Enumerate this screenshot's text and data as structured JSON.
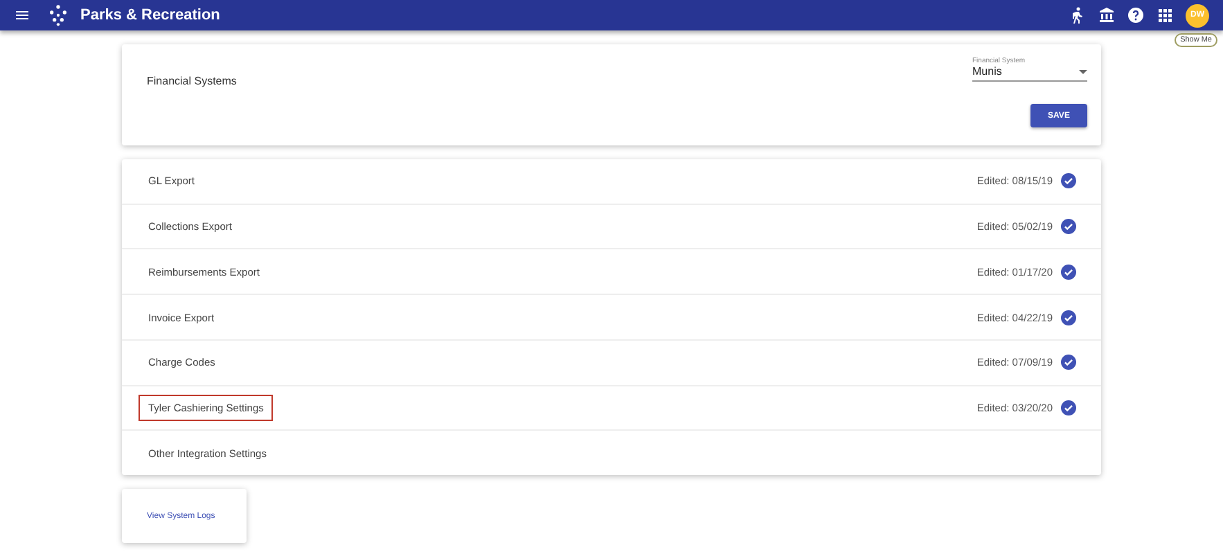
{
  "app_bar": {
    "title": "Parks & Recreation",
    "avatar": "DW",
    "tooltip": "Show Me"
  },
  "financial_card": {
    "label": "Financial Systems",
    "select": {
      "label": "Financial System",
      "value": "Munis"
    },
    "save_button": "SAVE"
  },
  "settings": [
    {
      "name": "GL Export",
      "edited": "Edited: 08/15/19",
      "verified": true,
      "highlighted": false
    },
    {
      "name": "Collections Export",
      "edited": "Edited: 05/02/19",
      "verified": true,
      "highlighted": false
    },
    {
      "name": "Reimbursements Export",
      "edited": "Edited: 01/17/20",
      "verified": true,
      "highlighted": false
    },
    {
      "name": "Invoice Export",
      "edited": "Edited: 04/22/19",
      "verified": true,
      "highlighted": false
    },
    {
      "name": "Charge Codes",
      "edited": "Edited: 07/09/19",
      "verified": true,
      "highlighted": false
    },
    {
      "name": "Tyler Cashiering Settings",
      "edited": "Edited: 03/20/20",
      "verified": true,
      "highlighted": true
    },
    {
      "name": "Other Integration Settings",
      "verified": false,
      "highlighted": false
    }
  ],
  "logs_link": "View System Logs"
}
